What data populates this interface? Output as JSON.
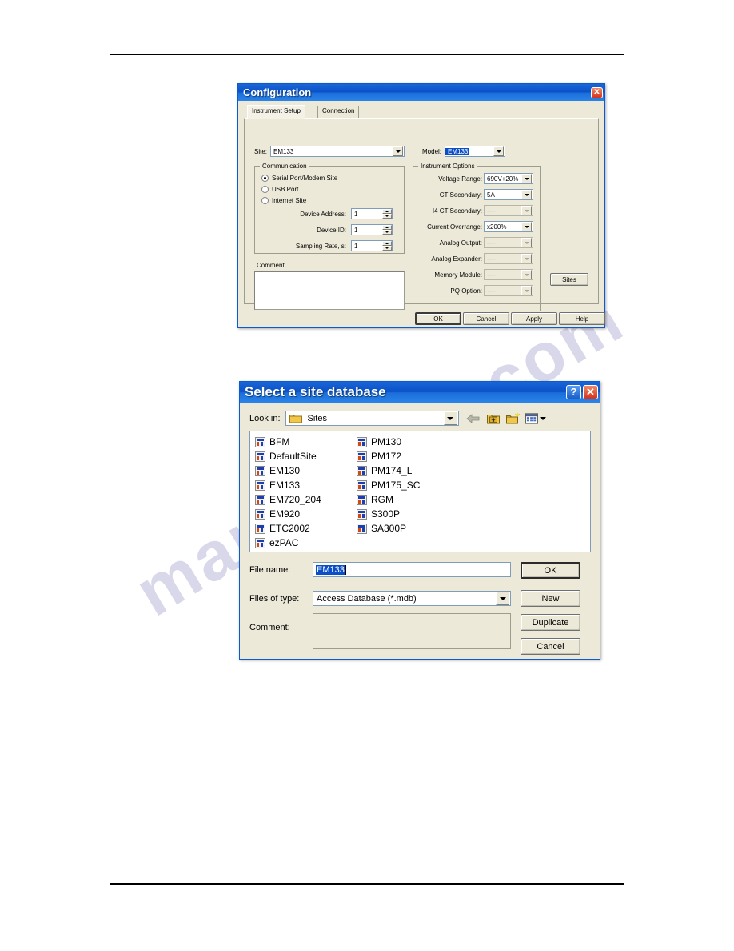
{
  "page": {
    "background_color": "#ffffff",
    "watermark_text": "manualslib.com"
  },
  "config_dialog": {
    "title": "Configuration",
    "close_label": "✕",
    "tabs": [
      {
        "label": "Instrument Setup",
        "active": true
      },
      {
        "label": "Connection",
        "active": false
      }
    ],
    "site": {
      "label": "Site:",
      "value": "EM133"
    },
    "model": {
      "label": "Model:",
      "value": "EM133",
      "selected": true
    },
    "communication": {
      "group_label": "Communication",
      "options": [
        {
          "label": "Serial Port/Modem Site",
          "checked": true
        },
        {
          "label": "USB Port",
          "checked": false
        },
        {
          "label": "Internet Site",
          "checked": false
        }
      ],
      "fields": [
        {
          "label": "Device Address:",
          "value": "1"
        },
        {
          "label": "Device ID:",
          "value": "1"
        },
        {
          "label": "Sampling Rate, s:",
          "value": "1"
        }
      ]
    },
    "comment": {
      "group_label": "Comment",
      "value": ""
    },
    "instrument_options": {
      "group_label": "Instrument Options",
      "fields": [
        {
          "label": "Voltage Range:",
          "value": "690V+20%",
          "disabled": false
        },
        {
          "label": "CT Secondary:",
          "value": "5A",
          "disabled": false
        },
        {
          "label": "I4 CT Secondary:",
          "value": "----",
          "disabled": true
        },
        {
          "label": "Current Overrange:",
          "value": "x200%",
          "disabled": false
        },
        {
          "label": "Analog Output:",
          "value": "----",
          "disabled": true
        },
        {
          "label": "Analog Expander:",
          "value": "----",
          "disabled": true
        },
        {
          "label": "Memory Module:",
          "value": "----",
          "disabled": true
        },
        {
          "label": "PQ Option:",
          "value": "----",
          "disabled": true
        }
      ],
      "sites_button": "Sites"
    },
    "buttons": [
      {
        "label": "OK",
        "default": true
      },
      {
        "label": "Cancel",
        "default": false
      },
      {
        "label": "Apply",
        "default": false
      },
      {
        "label": "Help",
        "default": false
      }
    ]
  },
  "select_dialog": {
    "title": "Select a site database",
    "help_label": "?",
    "close_label": "✕",
    "look_in": {
      "label": "Look in:",
      "value": "Sites"
    },
    "toolbar": [
      {
        "name": "back-arrow",
        "tooltip": "Back"
      },
      {
        "name": "up-one-level",
        "tooltip": "Up One Level"
      },
      {
        "name": "new-folder",
        "tooltip": "Create New Folder"
      },
      {
        "name": "views",
        "tooltip": "Views"
      }
    ],
    "files": [
      "BFM",
      "DefaultSite",
      "EM130",
      "EM133",
      "EM720_204",
      "EM920",
      "ETC2002",
      "ezPAC",
      "PM130",
      "PM172",
      "PM174_L",
      "PM175_SC",
      "RGM",
      "S300P",
      "SA300P"
    ],
    "file_name": {
      "label": "File name:",
      "value": "EM133",
      "selected": true
    },
    "files_of_type": {
      "label": "Files of type:",
      "value": "Access Database (*.mdb)"
    },
    "comment": {
      "label": "Comment:",
      "value": ""
    },
    "buttons": [
      {
        "label": "OK",
        "default": true
      },
      {
        "label": "New",
        "default": false
      },
      {
        "label": "Duplicate",
        "default": false
      },
      {
        "label": "Cancel",
        "default": false
      }
    ]
  }
}
